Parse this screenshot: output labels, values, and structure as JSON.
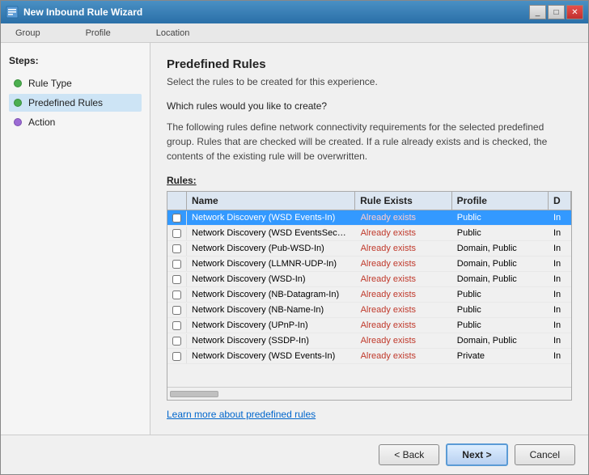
{
  "window": {
    "title": "New Inbound Rule Wizard",
    "nav_items": [
      "Group",
      "Profile",
      "Location"
    ]
  },
  "page": {
    "title": "Predefined Rules",
    "subtitle": "Select the rules to be created for this experience.",
    "question": "Which rules would you like to create?",
    "description": "The following rules define network connectivity requirements for the selected predefined group. Rules that are checked will be created. If a rule already exists and is checked, the contents of the existing rule will be overwritten.",
    "rules_label": "Rules:",
    "learn_link": "Learn more about predefined rules"
  },
  "sidebar": {
    "steps_label": "Steps:",
    "items": [
      {
        "label": "Rule Type",
        "dot": "green"
      },
      {
        "label": "Predefined Rules",
        "dot": "green",
        "active": true
      },
      {
        "label": "Action",
        "dot": "purple"
      }
    ]
  },
  "table": {
    "columns": [
      "Name",
      "Rule Exists",
      "Profile",
      "D"
    ],
    "rows": [
      {
        "name": "Network Discovery (WSD Events-In)",
        "rule_exists": "Already exists",
        "profile": "Public",
        "d": "In",
        "selected": true
      },
      {
        "name": "Network Discovery (WSD EventsSecure-In)",
        "rule_exists": "Already exists",
        "profile": "Public",
        "d": "In",
        "selected": false
      },
      {
        "name": "Network Discovery (Pub-WSD-In)",
        "rule_exists": "Already exists",
        "profile": "Domain, Public",
        "d": "In",
        "selected": false
      },
      {
        "name": "Network Discovery (LLMNR-UDP-In)",
        "rule_exists": "Already exists",
        "profile": "Domain, Public",
        "d": "In",
        "selected": false
      },
      {
        "name": "Network Discovery (WSD-In)",
        "rule_exists": "Already exists",
        "profile": "Domain, Public",
        "d": "In",
        "selected": false
      },
      {
        "name": "Network Discovery (NB-Datagram-In)",
        "rule_exists": "Already exists",
        "profile": "Public",
        "d": "In",
        "selected": false
      },
      {
        "name": "Network Discovery (NB-Name-In)",
        "rule_exists": "Already exists",
        "profile": "Public",
        "d": "In",
        "selected": false
      },
      {
        "name": "Network Discovery (UPnP-In)",
        "rule_exists": "Already exists",
        "profile": "Public",
        "d": "In",
        "selected": false
      },
      {
        "name": "Network Discovery (SSDP-In)",
        "rule_exists": "Already exists",
        "profile": "Domain, Public",
        "d": "In",
        "selected": false
      },
      {
        "name": "Network Discovery (WSD Events-In)",
        "rule_exists": "Already exists",
        "profile": "Private",
        "d": "In",
        "selected": false
      }
    ]
  },
  "footer": {
    "back_label": "< Back",
    "next_label": "Next >",
    "cancel_label": "Cancel"
  },
  "colors": {
    "selected_row_bg": "#3399ff",
    "selected_row_text": "#ffffff",
    "rule_exists_color": "#c0392b"
  }
}
